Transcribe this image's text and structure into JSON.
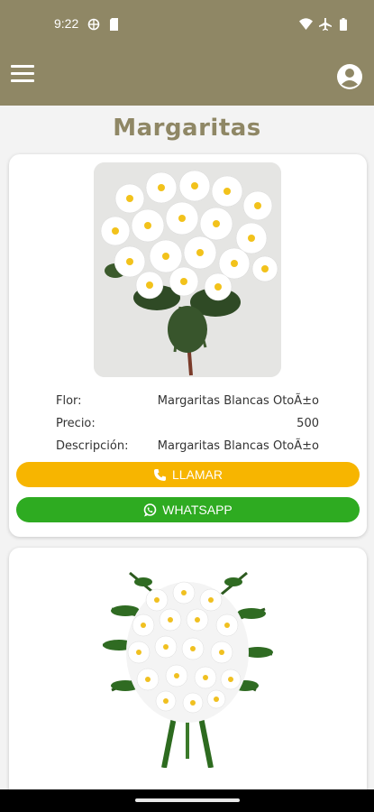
{
  "status_bar": {
    "time": "9:22"
  },
  "header": {
    "menu_icon": "hamburger-menu-icon",
    "account_icon": "account-circle-icon"
  },
  "page": {
    "title": "Margaritas"
  },
  "products": [
    {
      "image": "white-daisy-bouquet-photo",
      "fields": [
        {
          "key": "Flor:",
          "value": "Margaritas Blancas OtoÃ±o"
        },
        {
          "key": "Precio:",
          "value": "500"
        },
        {
          "key": "Descripción:",
          "value": "Margaritas Blancas OtoÃ±o"
        }
      ],
      "call_label": "LLAMAR",
      "whatsapp_label": "WHATSAPP"
    },
    {
      "image": "white-daisy-arrangement-with-ferns-photo"
    }
  ],
  "colors": {
    "header": "#8f8765",
    "title": "#8f8765",
    "call_button": "#f7b500",
    "whatsapp_button": "#2eab21"
  }
}
